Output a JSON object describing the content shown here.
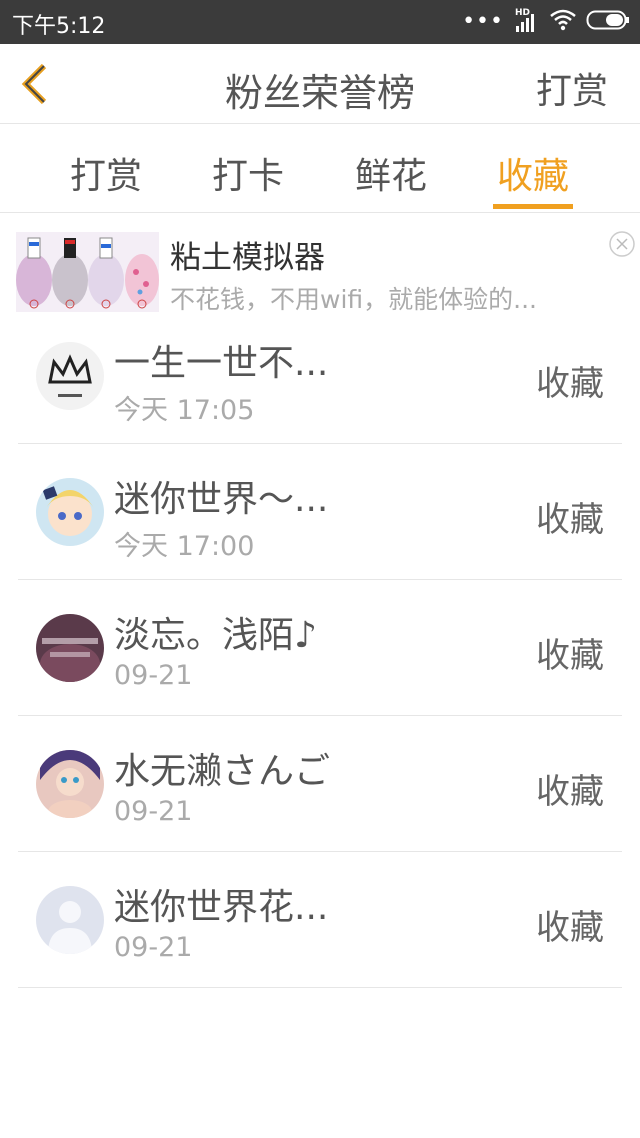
{
  "status": {
    "time": "下午5:12",
    "dots": "•••",
    "hd": "HD",
    "icons": [
      "signal-icon",
      "wifi-icon",
      "battery-icon"
    ]
  },
  "header": {
    "title": "粉丝荣誉榜",
    "right_action": "打赏",
    "back_icon": "chevron-left-icon"
  },
  "tabs": [
    {
      "label": "打赏",
      "active": false
    },
    {
      "label": "打卡",
      "active": false
    },
    {
      "label": "鲜花",
      "active": false
    },
    {
      "label": "收藏",
      "active": true
    }
  ],
  "ad": {
    "title": "粘土模拟器",
    "desc": "不花钱，不用wifi，就能体验的..."
  },
  "list": [
    {
      "name": "一生一世不...",
      "time": "今天 17:05",
      "action": "收藏",
      "avatar": "crown-avatar"
    },
    {
      "name": "迷你世界～...",
      "time": "今天 17:00",
      "action": "收藏",
      "avatar": "anime-girl-avatar"
    },
    {
      "name": "淡忘。浅陌♪",
      "time": "09-21",
      "action": "收藏",
      "avatar": "dark-text-avatar"
    },
    {
      "name": "水无濑さんご",
      "time": "09-21",
      "action": "收藏",
      "avatar": "anime-character-avatar"
    },
    {
      "name": "迷你世界花...",
      "time": "09-21",
      "action": "收藏",
      "avatar": "default-user-avatar"
    }
  ],
  "colors": {
    "accent": "#f0a020",
    "status_bar": "#3b3b3b",
    "text": "#555555",
    "secondary_text": "#aaaaaa"
  }
}
